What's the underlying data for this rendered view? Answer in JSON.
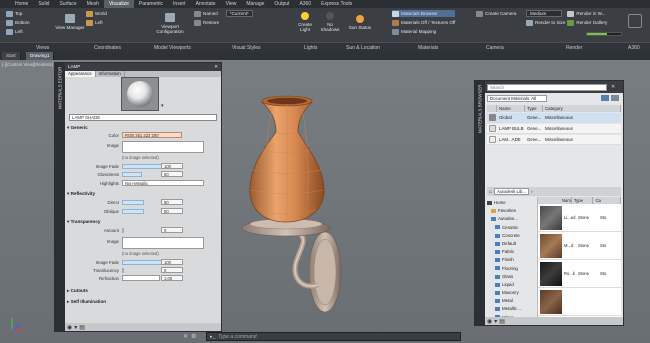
{
  "ribbon": {
    "tabs": [
      "Home",
      "Solid",
      "Surface",
      "Mesh",
      "Visualize",
      "Parametric",
      "Insert",
      "Annotate",
      "View",
      "Manage",
      "Output",
      "A360",
      "Express Tools"
    ],
    "active_tab": "Visualize",
    "views_tools": [
      "Top",
      "Bottom",
      "Left"
    ],
    "coord_tools": [
      "View Manager",
      "World",
      "Left"
    ],
    "model_viewports": "Viewport Configuration",
    "visual_style": {
      "named": "Named",
      "restore": "Restore",
      "current": "*Current*"
    },
    "lights": {
      "create_light": "Create Light",
      "no_shadows": "No Shadows"
    },
    "sun": {
      "sun_status": "Sun Status"
    },
    "materials": {
      "browser": "Materials Browser",
      "off": "Materials Off / Textures Off",
      "mapping": "Material Mapping"
    },
    "camera": {
      "create": "Create Camera"
    },
    "render": {
      "quality": "Medium",
      "render_to_size": "Render to Size",
      "render_in_window": "Render in W...",
      "render_gallery": "Render Gallery"
    },
    "panels": [
      "Views",
      "Coordinates",
      "Model Viewports",
      "Visual Styles",
      "Lights",
      "Sun & Location",
      "Materials",
      "Camera",
      "Render",
      "A360"
    ]
  },
  "doc_tabs": [
    "Start",
    "Drawing1"
  ],
  "viewport_label": "[-][Custom View][Realistic]",
  "command": {
    "placeholder": "Type a command"
  },
  "materials_editor": {
    "title": "MATERIALS EDITOR",
    "header_left": "LAMP",
    "subtabs": [
      "Appearance",
      "Information"
    ],
    "material_name": "LAMP SHADE",
    "sections": {
      "generic": "Generic",
      "reflectivity": "Reflectivity",
      "transparency": "Transparency",
      "cutouts": "Cutouts",
      "self_illumination": "Self Illumination"
    },
    "generic": {
      "color_label": "Color",
      "color_value": "RGB 251 222 200",
      "image_label": "Image",
      "image_note": "(no image selected)",
      "image_fade_label": "Image Fade",
      "image_fade_value": "100",
      "glossiness_label": "Glossiness",
      "glossiness_value": "50",
      "highlights_label": "Highlights",
      "highlights_value": "Non-Metallic"
    },
    "reflectivity": {
      "direct_label": "Direct",
      "direct_value": "50",
      "oblique_label": "Oblique",
      "oblique_value": "50"
    },
    "transparency": {
      "amount_label": "Amount",
      "amount_value": "0",
      "image_label": "Image",
      "image_note": "(no image selected)",
      "image_fade_label": "Image Fade",
      "image_fade_value": "100",
      "translucency_label": "Translucency",
      "translucency_value": "0",
      "refraction_label": "Refraction",
      "refraction_value": "1.00"
    }
  },
  "materials_browser": {
    "title": "MATERIALS BROWSER",
    "search_placeholder": "Search",
    "doc_materials": "Document Materials: All",
    "columns": [
      "Name",
      "Type",
      "Category"
    ],
    "rows": [
      {
        "name": "Global",
        "type": "Gene...",
        "category": "Miscellaneous"
      },
      {
        "name": "LAMP BULB",
        "type": "Gene...",
        "category": "Miscellaneous"
      },
      {
        "name": "LAM...ADE",
        "type": "Gene...",
        "category": "Miscellaneous"
      }
    ],
    "library_label": "Autodesk Lib...",
    "tree": [
      "Home",
      "Favorites",
      "Autodes...",
      "Ceramic",
      "Concrete",
      "Default",
      "Fabric",
      "Finish",
      "Flooring",
      "Glass",
      "Liquid",
      "Masonry",
      "Metal",
      "Metallic ...",
      "Mirror"
    ],
    "grid_columns": [
      "Nam",
      "Type",
      "Ca"
    ],
    "grid_rows": [
      {
        "name": "Li...ed",
        "type": "Stone",
        "cat": "Sto"
      },
      {
        "name": "M...d",
        "type": "Stone",
        "cat": "Sto"
      },
      {
        "name": "Ro...k",
        "type": "Stone",
        "cat": "Sto"
      }
    ]
  }
}
